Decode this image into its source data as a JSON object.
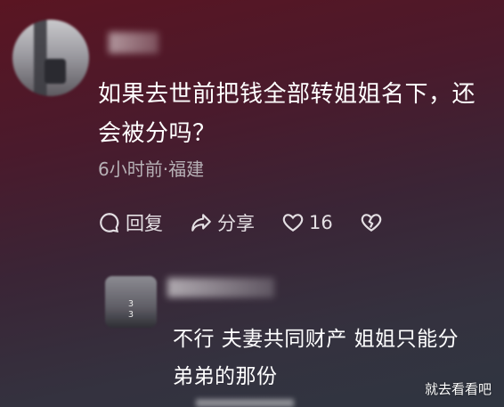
{
  "comment": {
    "text": "如果去世前把钱全部转姐姐名下，还会被分吗？",
    "meta": "6小时前·福建"
  },
  "actions": {
    "reply_label": "回复",
    "share_label": "分享",
    "like_count": "16"
  },
  "reply": {
    "avatar_label": "3\n3",
    "text_line1": "不行 夫妻共同财产 姐姐只能分",
    "text_line2": "弟弟的那份"
  },
  "watermark": "就去看看吧",
  "icons": [
    "reply-icon",
    "share-icon",
    "heart-icon",
    "dislike-icon"
  ]
}
